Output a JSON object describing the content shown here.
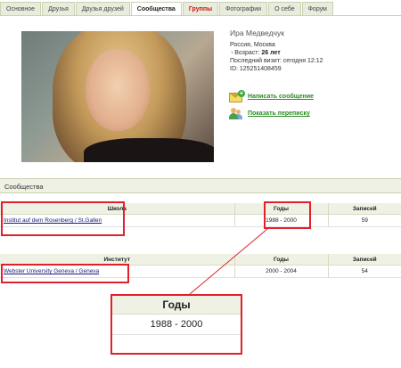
{
  "tabs": [
    {
      "label": "Основное"
    },
    {
      "label": "Друзья"
    },
    {
      "label": "Друзья друзей"
    },
    {
      "label": "Сообщества"
    },
    {
      "label": "Группы"
    },
    {
      "label": "Фотографии"
    },
    {
      "label": "О себе"
    },
    {
      "label": "Форум"
    }
  ],
  "profile": {
    "name": "Ира Медведчук",
    "location": "Россия, Москва",
    "age_label": "Возраст:",
    "age_value": "26 лет",
    "last_visit": "Последний визит: сегодня 12:12",
    "id_line": "ID: 125251408459"
  },
  "actions": {
    "write_message": "Написать сообщение",
    "show_correspondence": "Показать переписку"
  },
  "section_title": "Сообщества",
  "school_table": {
    "headers": [
      "Школа",
      "Годы",
      "Записей"
    ],
    "rows": [
      {
        "name": "Institut auf dem Rosenberg / St.Gallen",
        "years": "1988 - 2000",
        "entries": "59"
      }
    ]
  },
  "institute_table": {
    "headers": [
      "Институт",
      "Годы",
      "Записей"
    ],
    "rows": [
      {
        "name": "Webster University Geneva / Geneva",
        "years": "2000 - 2004",
        "entries": "54"
      }
    ]
  },
  "zoom": {
    "header": "Годы",
    "value": "1988 - 2000"
  },
  "colors": {
    "highlight": "#e0202a",
    "link_green": "#2d8a25",
    "tab_accent": "#d01010",
    "header_bg": "#eef1e4"
  }
}
